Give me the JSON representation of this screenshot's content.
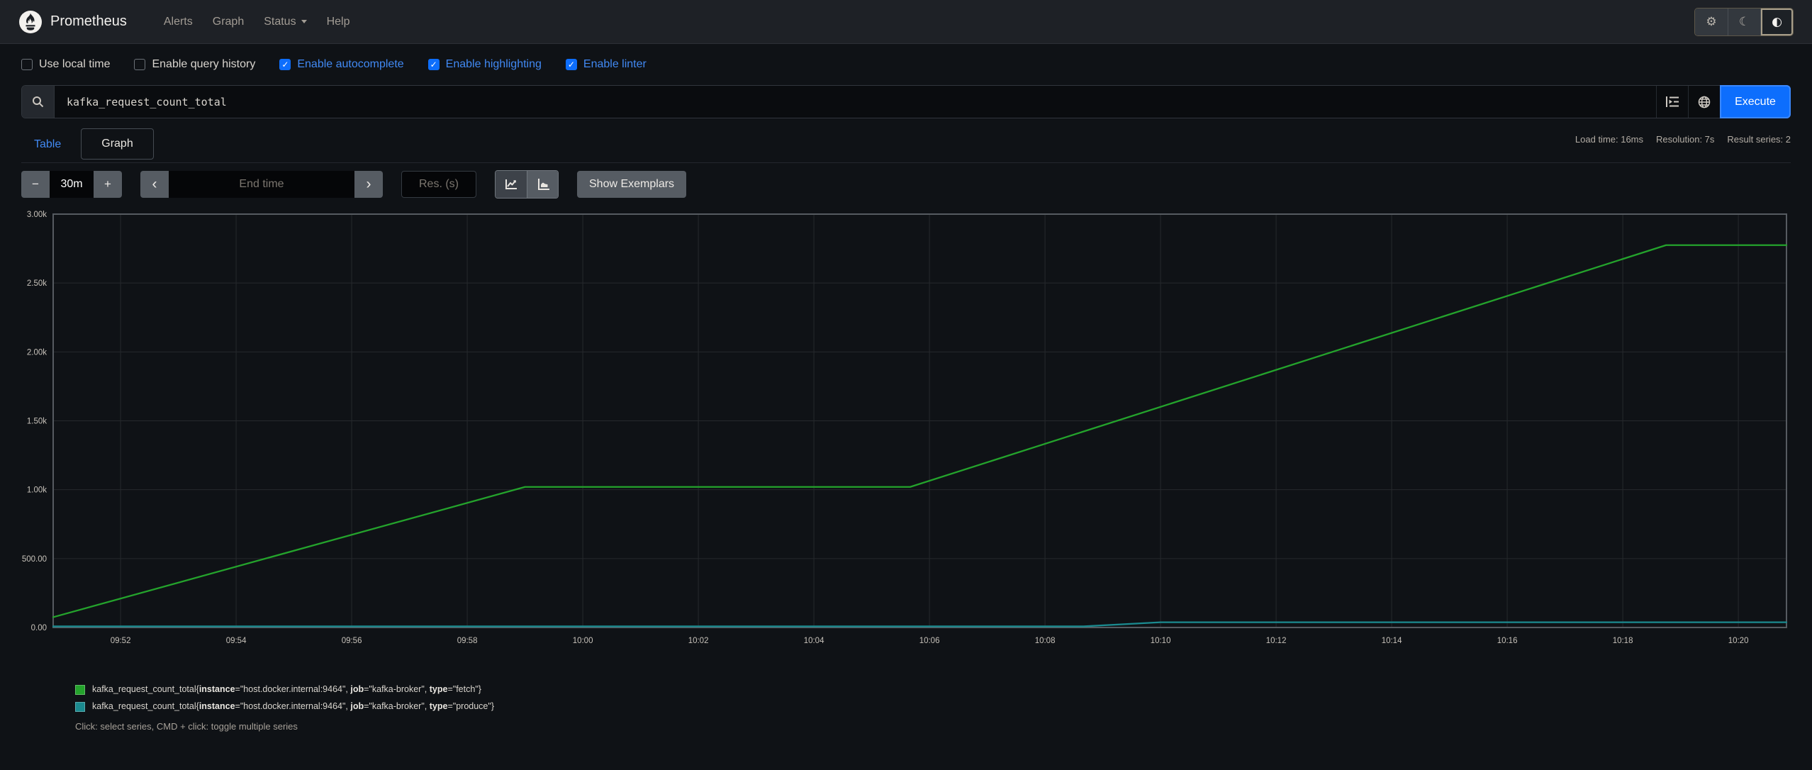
{
  "navbar": {
    "brand": "Prometheus",
    "items": [
      {
        "label": "Alerts",
        "caret": false
      },
      {
        "label": "Graph",
        "caret": false
      },
      {
        "label": "Status",
        "caret": true
      },
      {
        "label": "Help",
        "caret": false
      }
    ],
    "theme_toggle": [
      {
        "name": "gear-icon",
        "glyph": "⚙",
        "active": false
      },
      {
        "name": "moon-icon",
        "glyph": "☾",
        "active": false
      },
      {
        "name": "contrast-icon",
        "glyph": "◐",
        "active": true
      }
    ]
  },
  "options": [
    {
      "label": "Use local time",
      "checked": false
    },
    {
      "label": "Enable query history",
      "checked": false
    },
    {
      "label": "Enable autocomplete",
      "checked": true
    },
    {
      "label": "Enable highlighting",
      "checked": true
    },
    {
      "label": "Enable linter",
      "checked": true
    }
  ],
  "query": {
    "value": "kafka_request_count_total",
    "execute_label": "Execute"
  },
  "tabs": [
    {
      "label": "Table",
      "active": false
    },
    {
      "label": "Graph",
      "active": true
    }
  ],
  "stats": {
    "load_time": "Load time: 16ms",
    "resolution": "Resolution: 7s",
    "result_series": "Result series: 2"
  },
  "controls": {
    "minus_label": "−",
    "range_value": "30m",
    "plus_label": "+",
    "prev_label": "‹",
    "end_time_placeholder": "End time",
    "next_label": "›",
    "res_placeholder": "Res. (s)",
    "show_exemplars_label": "Show Exemplars"
  },
  "chart_data": {
    "type": "line",
    "x_range": [
      "09:50:50",
      "10:20:50"
    ],
    "ylim": [
      0,
      3000
    ],
    "grid": true,
    "legend_position": "below",
    "x_ticks": [
      "09:52",
      "09:54",
      "09:56",
      "09:58",
      "10:00",
      "10:02",
      "10:04",
      "10:06",
      "10:08",
      "10:10",
      "10:12",
      "10:14",
      "10:16",
      "10:18",
      "10:20"
    ],
    "y_ticks": [
      {
        "value": 0,
        "label": "0.00"
      },
      {
        "value": 500,
        "label": "500.00"
      },
      {
        "value": 1000,
        "label": "1.00k"
      },
      {
        "value": 1500,
        "label": "1.50k"
      },
      {
        "value": 2000,
        "label": "2.00k"
      },
      {
        "value": 2500,
        "label": "2.50k"
      },
      {
        "value": 3000,
        "label": "3.00k"
      }
    ],
    "series": [
      {
        "metric": "kafka_request_count_total",
        "labels": [
          {
            "key": "instance",
            "value": "host.docker.internal:9464"
          },
          {
            "key": "job",
            "value": "kafka-broker"
          },
          {
            "key": "type",
            "value": "fetch"
          }
        ],
        "color": "#24a32c",
        "points": [
          [
            "09:50:50",
            75
          ],
          [
            "09:59:00",
            1020
          ],
          [
            "10:05:40",
            1020
          ],
          [
            "10:18:45",
            2775
          ],
          [
            "10:20:50",
            2775
          ]
        ]
      },
      {
        "metric": "kafka_request_count_total",
        "labels": [
          {
            "key": "instance",
            "value": "host.docker.internal:9464"
          },
          {
            "key": "job",
            "value": "kafka-broker"
          },
          {
            "key": "type",
            "value": "produce"
          }
        ],
        "color": "#1b8a8f",
        "points": [
          [
            "09:50:50",
            8
          ],
          [
            "10:08:40",
            8
          ],
          [
            "10:10:00",
            38
          ],
          [
            "10:20:50",
            38
          ]
        ]
      }
    ]
  },
  "footer_hint": "Click: select series, CMD + click: toggle multiple series"
}
